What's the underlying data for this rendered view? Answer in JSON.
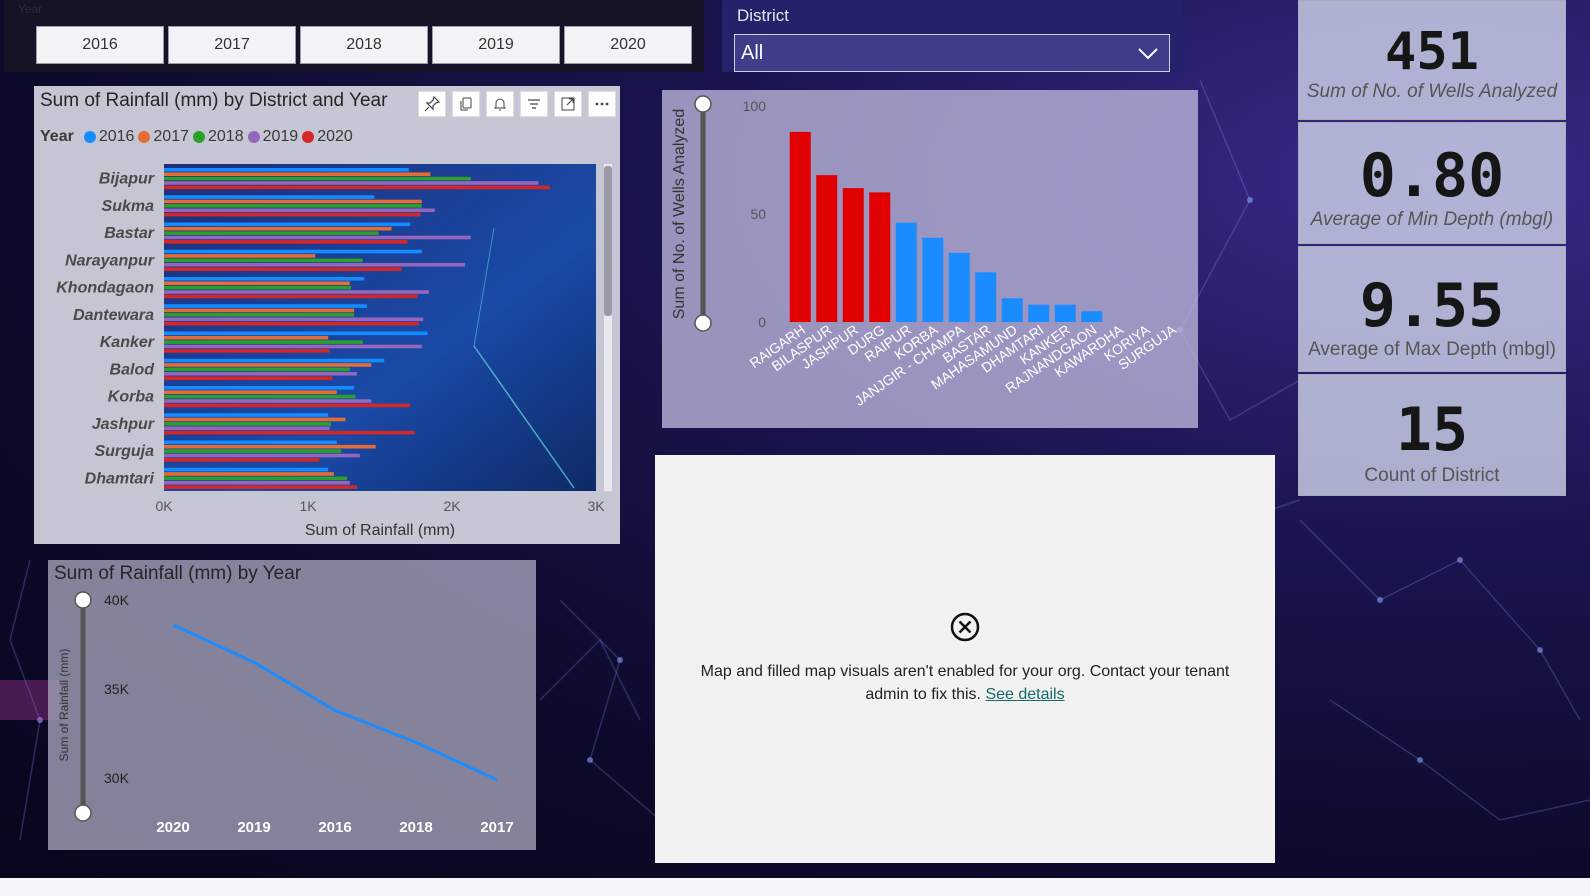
{
  "year_slicer": {
    "title": "Year",
    "options": [
      "2016",
      "2017",
      "2018",
      "2019",
      "2020"
    ]
  },
  "district_slicer": {
    "label": "District",
    "selected": "All"
  },
  "kpis": [
    {
      "value": "451",
      "caption": "Sum of No. of Wells Analyzed"
    },
    {
      "value": "0.80",
      "caption": "Average of Min Depth (mbgl)"
    },
    {
      "value": "9.55",
      "caption": "Average of Max Depth (mbgl)"
    },
    {
      "value": "15",
      "caption": "Count of District"
    }
  ],
  "colors": {
    "y2016": "#118DFF",
    "y2017": "#E66C37",
    "y2018": "#2CA02C",
    "y2019": "#9467BD",
    "y2020": "#D62728",
    "wells_red": "#E00000",
    "wells_blue": "#1A8CFF",
    "line": "#1A8CFF"
  },
  "icons": {
    "toolbar": [
      "pin-icon",
      "copy-icon",
      "bell-icon",
      "filter-icon",
      "focus-mode-icon",
      "more-options-icon"
    ],
    "dropdown": "chevron-down-icon",
    "map_error": "close-circle-icon"
  },
  "chart_data": [
    {
      "type": "bar",
      "orientation": "horizontal",
      "title": "Sum of Rainfall (mm) by District and Year",
      "legend_title": "Year",
      "xlabel": "Sum of Rainfall (mm)",
      "ylabel": "",
      "xlim": [
        0,
        3000
      ],
      "xticks": [
        "0K",
        "1K",
        "2K",
        "3K"
      ],
      "categories": [
        "Bijapur",
        "Sukma",
        "Bastar",
        "Narayanpur",
        "Khondagaon",
        "Dantewara",
        "Kanker",
        "Balod",
        "Korba",
        "Jashpur",
        "Surguja",
        "Dhamtari"
      ],
      "series": [
        {
          "name": "2016",
          "values": [
            1700,
            1460,
            1710,
            1790,
            1390,
            1410,
            1830,
            1530,
            1320,
            1140,
            1200,
            1140
          ]
        },
        {
          "name": "2017",
          "values": [
            1850,
            1790,
            1580,
            1050,
            1290,
            1320,
            1140,
            1440,
            1200,
            1260,
            1470,
            1180
          ]
        },
        {
          "name": "2018",
          "values": [
            2130,
            1790,
            1490,
            1380,
            1300,
            1320,
            1380,
            1290,
            1330,
            1160,
            1230,
            1270
          ]
        },
        {
          "name": "2019",
          "values": [
            2600,
            1880,
            2130,
            2090,
            1840,
            1800,
            1790,
            1340,
            1440,
            1150,
            1360,
            1290
          ]
        },
        {
          "name": "2020",
          "values": [
            2680,
            1780,
            1690,
            1650,
            1760,
            1770,
            1150,
            1170,
            1710,
            1740,
            1080,
            1340
          ]
        }
      ]
    },
    {
      "type": "bar",
      "title": "",
      "xlabel": "",
      "ylabel": "Sum of No. of Wells Analyzed",
      "ylim": [
        0,
        100
      ],
      "yticks": [
        "0",
        "50",
        "100"
      ],
      "categories": [
        "RAIGARH",
        "BILASPUR",
        "JASHPUR",
        "DURG",
        "RAIPUR",
        "KORBA",
        "JANJGIR - CHAMPA",
        "BASTAR",
        "MAHASAMUND",
        "DHAMTARI",
        "KANKER",
        "RAJNANDGAON",
        "KAWARDHA",
        "KORIYA",
        "SURGUJA"
      ],
      "values": [
        88,
        68,
        62,
        60,
        46,
        39,
        32,
        23,
        11,
        8,
        8,
        5,
        0,
        0,
        0
      ]
    },
    {
      "type": "line",
      "title": "Sum of Rainfall (mm) by Year",
      "xlabel": "",
      "ylabel": "Sum of Rainfall (mm)",
      "ylim": [
        28000,
        40000
      ],
      "yticks": [
        "30K",
        "35K",
        "40K"
      ],
      "categories": [
        "2020",
        "2019",
        "2016",
        "2018",
        "2017"
      ],
      "values": [
        38600,
        36500,
        33800,
        32000,
        29900
      ]
    }
  ],
  "map_error": {
    "message_line1": "Map and filled map visuals aren't enabled for your org. Contact your tenant",
    "message_line2": "admin to fix this.",
    "link": "See details"
  }
}
